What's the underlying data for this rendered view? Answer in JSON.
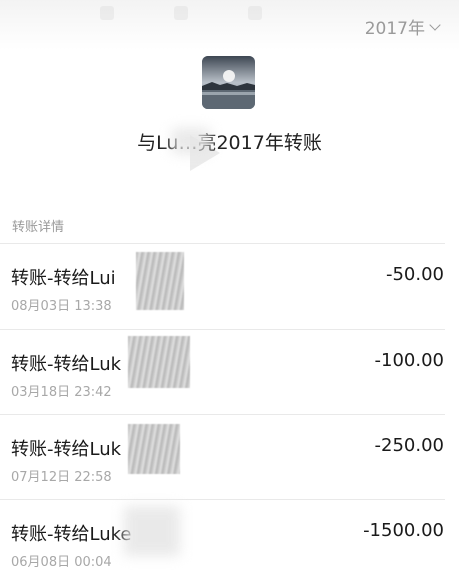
{
  "header": {
    "year_label": "2017年"
  },
  "summary": {
    "title": "与Lu…亮2017年转账"
  },
  "section": {
    "label": "转账详情"
  },
  "transactions": [
    {
      "title": "转账-转给Lui",
      "time": "08月03日 13:38",
      "amount": "-50.00"
    },
    {
      "title": "转账-转给Luk",
      "time": "03月18日 23:42",
      "amount": "-100.00"
    },
    {
      "title": "转账-转给Luk",
      "time": "07月12日 22:58",
      "amount": "-250.00"
    },
    {
      "title": "转账-转给Luke",
      "time": "06月08日 00:04",
      "amount": "-1500.00"
    }
  ],
  "icons": {
    "avatar": "avatar-photo",
    "year_dropdown": "chevron-down-icon"
  }
}
